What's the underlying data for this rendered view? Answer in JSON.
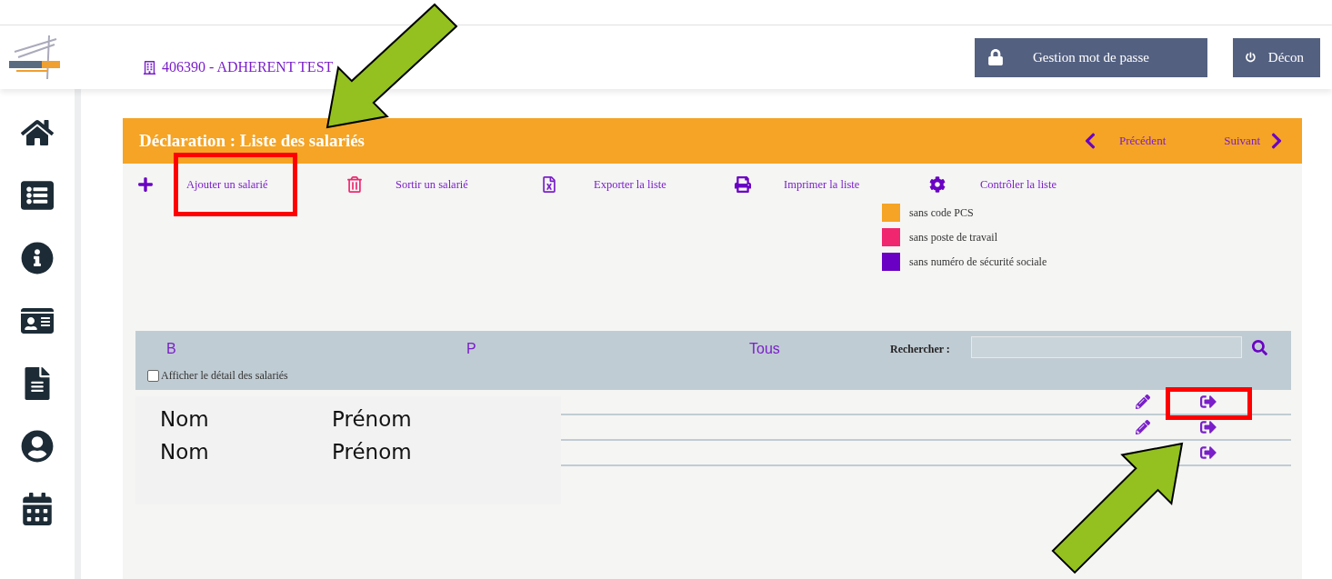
{
  "header": {
    "company": "406390 - ADHERENT TEST",
    "buttons": [
      {
        "kind": "lock",
        "label": "Gestion mot de passe"
      },
      {
        "kind": "power",
        "label": "Décon"
      }
    ]
  },
  "panel": {
    "title": "Déclaration : Liste des salariés",
    "previous": "Précédent",
    "next": "Suivant",
    "actions": [
      {
        "kind": "add",
        "label": "Ajouter un salarié"
      },
      {
        "kind": "remove",
        "label": "Sortir un salarié"
      },
      {
        "kind": "export",
        "label": "Exporter la liste"
      },
      {
        "kind": "print",
        "label": "Imprimer la liste"
      },
      {
        "kind": "check",
        "label": "Contrôler la liste"
      }
    ],
    "legend": [
      {
        "label": "sans code PCS",
        "color": "#f5a425"
      },
      {
        "label": "sans poste de travail",
        "color": "#f0266e"
      },
      {
        "label": "sans numéro de sécurité sociale",
        "color": "#6a00c4"
      }
    ]
  },
  "filters": {
    "letters": [
      "B",
      "P",
      "Tous"
    ],
    "search_label": "Rechercher :",
    "detail": {
      "label": "Afficher le détail des salariés",
      "checked": false
    }
  },
  "table": {
    "rows": [
      {
        "editable": true
      },
      {
        "editable": true
      },
      {
        "editable": false
      }
    ]
  },
  "popup": {
    "rows": [
      {
        "last_name": "Nom",
        "first_name": "Prénom"
      },
      {
        "last_name": "Nom",
        "first_name": "Prénom"
      }
    ]
  }
}
